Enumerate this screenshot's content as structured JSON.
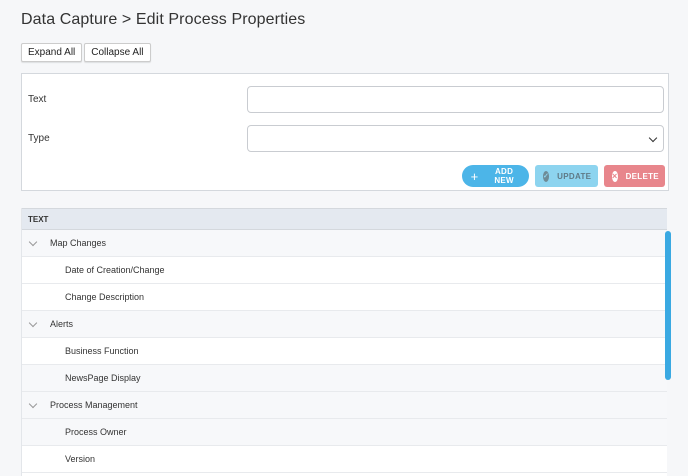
{
  "header": {
    "title": "Data Capture > Edit Process Properties"
  },
  "toolbar": {
    "expand_all": "Expand All",
    "collapse_all": "Collapse All"
  },
  "form": {
    "text_label": "Text",
    "text_value": "",
    "type_label": "Type",
    "type_value": ""
  },
  "actions": {
    "add_new": "ADD NEW",
    "update": "UPDATE",
    "delete": "DELETE"
  },
  "tree": {
    "column_header": "TEXT",
    "rows": [
      {
        "label": "Map Changes",
        "kind": "group"
      },
      {
        "label": "Date of Creation/Change",
        "kind": "child"
      },
      {
        "label": "Change Description",
        "kind": "child"
      },
      {
        "label": "Alerts",
        "kind": "group"
      },
      {
        "label": "Business Function",
        "kind": "child"
      },
      {
        "label": "NewsPage Display",
        "kind": "child"
      },
      {
        "label": "Process Management",
        "kind": "group"
      },
      {
        "label": "Process Owner",
        "kind": "child"
      },
      {
        "label": "Version",
        "kind": "child"
      }
    ]
  },
  "colors": {
    "accent_blue": "#4cb5e8",
    "update_blue": "#8dd4ef",
    "delete_red": "#e8868c",
    "scrollbar": "#3aa9e2"
  },
  "icons": {
    "add": "plus-icon",
    "update": "check-circle-icon",
    "delete": "close-circle-icon",
    "expand": "chevron-down-icon"
  }
}
